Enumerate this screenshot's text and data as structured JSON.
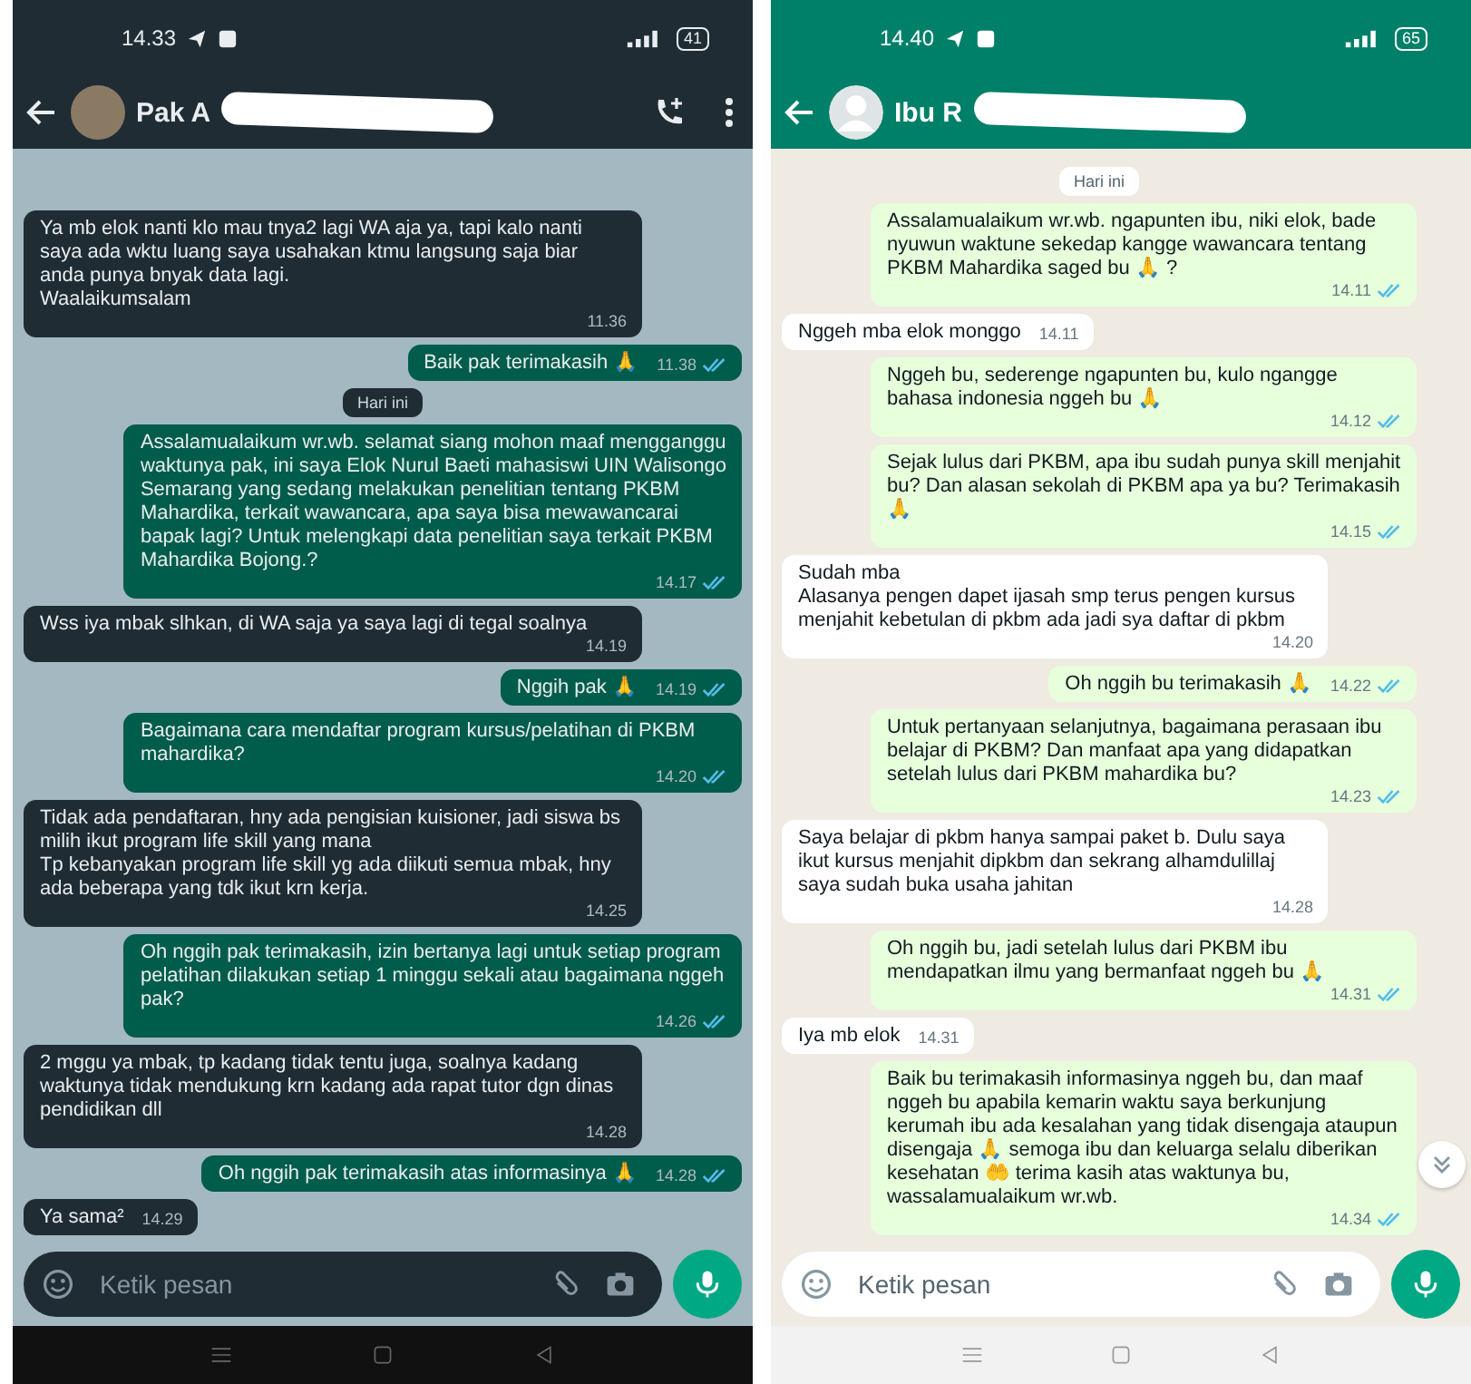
{
  "screens": [
    {
      "dark_mode": true,
      "status_bar": {
        "time": "14.33",
        "battery": "41"
      },
      "header": {
        "title": "Pak A",
        "has_photo": true,
        "call_button": true,
        "menu_button": true
      },
      "messages": [
        {
          "kind": "in",
          "text": "Ya mb elok nanti klo mau tnya2 lagi WA aja ya, tapi kalo nanti saya ada wktu luang saya usahakan ktmu langsung saja biar anda punya bnyak data lagi.\nWaalaikumsalam",
          "time": "11.36"
        },
        {
          "kind": "out",
          "text": "Baik pak terimakasih 🙏",
          "time": "11.38",
          "read": true
        },
        {
          "kind": "date",
          "text": "Hari ini"
        },
        {
          "kind": "out",
          "text": "Assalamualaikum wr.wb. selamat siang mohon maaf mengganggu waktunya pak, ini saya Elok Nurul Baeti mahasiswi UIN Walisongo Semarang yang sedang melakukan penelitian tentang PKBM Mahardika, terkait wawancara, apa saya bisa mewawancarai bapak lagi? Untuk melengkapi data penelitian saya terkait PKBM Mahardika Bojong.?",
          "time": "14.17",
          "read": true
        },
        {
          "kind": "in",
          "text": "Wss iya mbak slhkan, di WA saja ya saya lagi di tegal soalnya",
          "time": "14.19"
        },
        {
          "kind": "out",
          "text": "Nggih pak 🙏",
          "time": "14.19",
          "read": true
        },
        {
          "kind": "out",
          "text": "Bagaimana cara mendaftar program kursus/pelatihan di PKBM mahardika?",
          "time": "14.20",
          "read": true
        },
        {
          "kind": "in",
          "text": "Tidak ada pendaftaran, hny ada pengisian kuisioner, jadi siswa bs milih ikut program life skill yang mana\nTp kebanyakan program life skill yg ada diikuti semua mbak, hny ada beberapa yang tdk ikut krn kerja.",
          "time": "14.25"
        },
        {
          "kind": "out",
          "text": "Oh nggih pak terimakasih, izin bertanya lagi untuk setiap program pelatihan dilakukan setiap 1 minggu sekali atau bagaimana nggeh pak?",
          "time": "14.26",
          "read": true
        },
        {
          "kind": "in",
          "text": "2 mggu ya mbak, tp kadang tidak tentu juga, soalnya kadang waktunya tidak mendukung krn kadang ada rapat tutor dgn dinas pendidikan dll",
          "time": "14.28"
        },
        {
          "kind": "out",
          "text": "Oh nggih pak terimakasih atas informasinya 🙏",
          "time": "14.28",
          "read": true
        },
        {
          "kind": "in",
          "text": "Ya sama²",
          "time": "14.29"
        }
      ],
      "input": {
        "placeholder": "Ketik pesan"
      }
    },
    {
      "dark_mode": false,
      "status_bar": {
        "time": "14.40",
        "battery": "65"
      },
      "header": {
        "title": "Ibu R",
        "has_photo": false
      },
      "messages": [
        {
          "kind": "date",
          "text": "Hari ini"
        },
        {
          "kind": "out",
          "text": "Assalamualaikum wr.wb. ngapunten ibu, niki elok, bade nyuwun waktune sekedap kangge wawancara tentang PKBM Mahardika saged bu 🙏 ?",
          "time": "14.11",
          "read": true
        },
        {
          "kind": "in",
          "text": "Nggeh mba elok monggo",
          "time": "14.11"
        },
        {
          "kind": "out",
          "text": "Nggeh bu, sederenge ngapunten bu, kulo ngangge bahasa indonesia nggeh bu 🙏",
          "time": "14.12",
          "read": true
        },
        {
          "kind": "out",
          "text": "Sejak lulus dari PKBM, apa ibu sudah punya skill menjahit bu? Dan alasan sekolah di PKBM apa ya bu? Terimakasih 🙏",
          "time": "14.15",
          "read": true
        },
        {
          "kind": "in",
          "text": "Sudah mba\nAlasanya pengen dapet ijasah smp terus pengen kursus menjahit kebetulan di pkbm ada jadi sya daftar di pkbm",
          "time": "14.20"
        },
        {
          "kind": "out",
          "text": "Oh nggih bu terimakasih 🙏",
          "time": "14.22",
          "read": true
        },
        {
          "kind": "out",
          "text": "Untuk pertanyaan selanjutnya, bagaimana perasaan ibu belajar di PKBM? Dan manfaat apa yang didapatkan setelah lulus dari PKBM mahardika bu?",
          "time": "14.23",
          "read": true
        },
        {
          "kind": "in",
          "text": "Saya belajar di pkbm hanya sampai paket b. Dulu saya ikut kursus menjahit dipkbm dan sekrang alhamdulillaj saya sudah buka usaha jahitan",
          "time": "14.28"
        },
        {
          "kind": "out",
          "text": "Oh nggih bu, jadi setelah lulus dari PKBM ibu mendapatkan ilmu yang bermanfaat nggeh bu 🙏",
          "time": "14.31",
          "read": true
        },
        {
          "kind": "in",
          "text": "Iya mb elok",
          "time": "14.31"
        },
        {
          "kind": "out",
          "text": "Baik bu terimakasih informasinya nggeh bu, dan maaf nggeh bu apabila kemarin waktu saya berkunjung kerumah ibu ada kesalahan yang tidak disengaja ataupun disengaja 🙏 semoga ibu dan keluarga selalu diberikan kesehatan 🤲 terima kasih atas waktunya bu, wassalamualaikum wr.wb.",
          "time": "14.34",
          "read": true
        }
      ],
      "scroll_down_button": true,
      "input": {
        "placeholder": "Ketik pesan"
      }
    }
  ]
}
